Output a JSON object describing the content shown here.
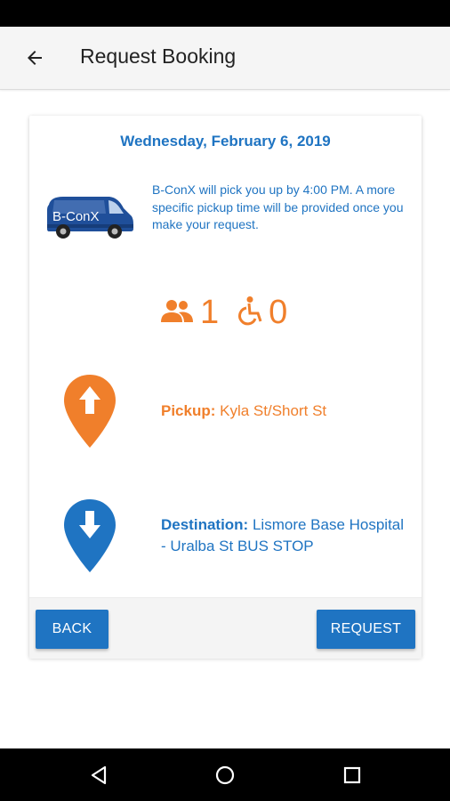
{
  "app_bar": {
    "title": "Request Booking"
  },
  "booking": {
    "date": "Wednesday, February 6, 2019",
    "van_logo_text": "B-ConX",
    "info": "B-ConX will pick you up by 4:00 PM. A more specific pickup time will be provided once you make your request.",
    "passengers": "1",
    "wheelchairs": "0",
    "pickup_label": "Pickup:",
    "pickup_value": "Kyla St/Short St",
    "destination_label": "Destination:",
    "destination_value": "Lismore Base Hospital - Uralba St BUS STOP"
  },
  "footer": {
    "back_label": "BACK",
    "request_label": "REQUEST"
  },
  "colors": {
    "primary": "#1f74c2",
    "accent": "#f07f2b"
  },
  "icons": {
    "back": "arrow-left-icon",
    "passengers": "people-icon",
    "wheelchair": "wheelchair-icon",
    "pickup": "map-pin-up-icon",
    "destination": "map-pin-down-icon",
    "nav_back": "triangle-back-icon",
    "nav_home": "circle-home-icon",
    "nav_recents": "square-recents-icon"
  }
}
